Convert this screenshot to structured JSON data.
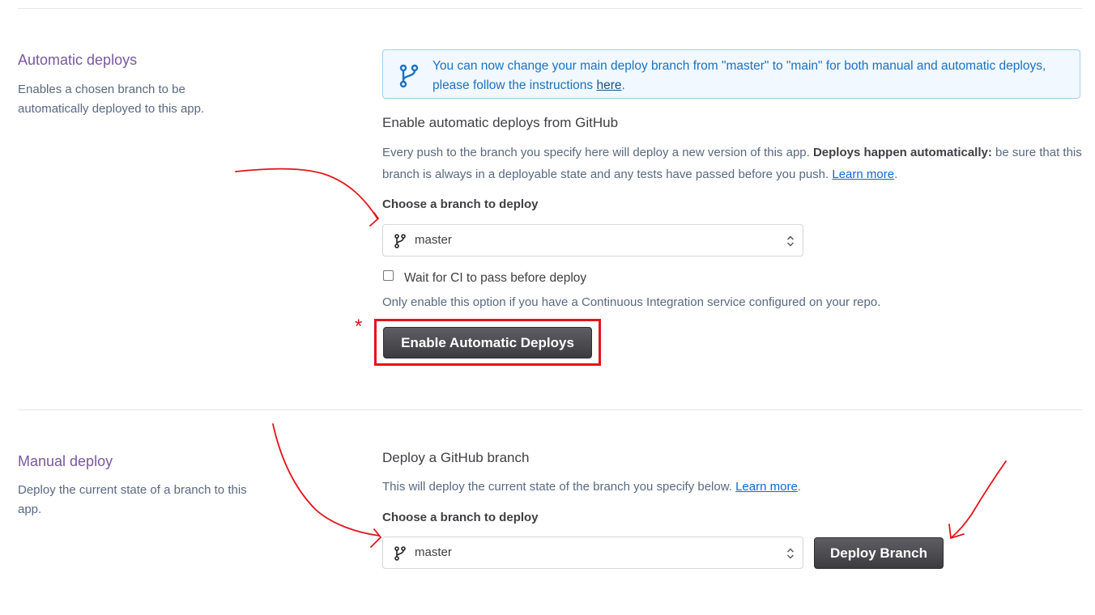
{
  "automatic": {
    "title": "Automatic deploys",
    "description": "Enables a chosen branch to be automatically deployed to this app.",
    "notice": {
      "text": "You can now change your main deploy branch from \"master\" to \"main\" for both manual and automatic deploys, please follow the instructions",
      "link": "here",
      "end": "."
    },
    "heading": "Enable automatic deploys from GitHub",
    "para_start": "Every push to the branch you specify here will deploy a new version of this app.",
    "para_bold": "Deploys happen automatically:",
    "para_end": "be sure that this branch is always in a deployable state and any tests have passed before you push.",
    "learn_more": "Learn more",
    "period": ".",
    "branch_label": "Choose a branch to deploy",
    "branch_value": "master",
    "ci_label": "Wait for CI to pass before deploy",
    "ci_help": "Only enable this option if you have a Continuous Integration service configured on your repo.",
    "enable_button": "Enable Automatic Deploys",
    "asterisk": "*"
  },
  "manual": {
    "title": "Manual deploy",
    "description": "Deploy the current state of a branch to this app.",
    "heading": "Deploy a GitHub branch",
    "para": "This will deploy the current state of the branch you specify below.",
    "learn_more": "Learn more",
    "period": ".",
    "branch_label": "Choose a branch to deploy",
    "branch_value": "master",
    "deploy_button": "Deploy Branch"
  },
  "colors": {
    "accent": "#79589f",
    "link": "#0c6ad7",
    "annotation": "#e3141b"
  },
  "icons": [
    "branch-icon",
    "chevron-updown-icon"
  ]
}
